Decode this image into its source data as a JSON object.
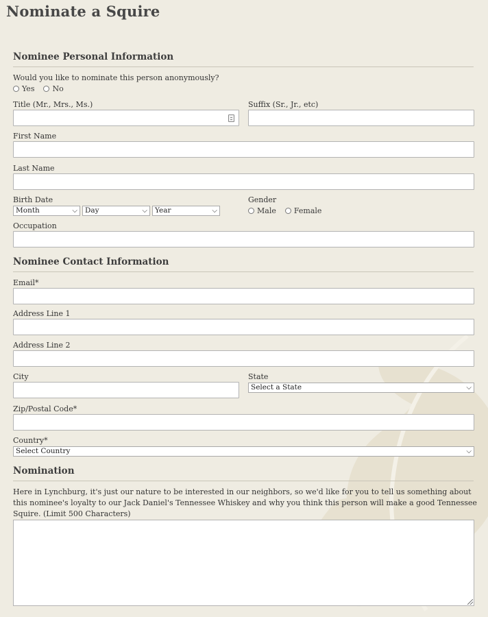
{
  "page": {
    "title": "Nominate a Squire"
  },
  "sections": {
    "personal": "Nominee Personal Information",
    "contact": "Nominee Contact Information",
    "nomination": "Nomination"
  },
  "anonymous": {
    "question": "Would you like to nominate this person anonymously?",
    "yes": "Yes",
    "no": "No"
  },
  "fields": {
    "title": "Title (Mr., Mrs., Ms.)",
    "suffix": "Suffix (Sr., Jr., etc)",
    "first_name": "First Name",
    "last_name": "Last Name",
    "birth_date": "Birth Date",
    "gender": "Gender",
    "occupation": "Occupation",
    "email": "Email*",
    "address1": "Address Line 1",
    "address2": "Address Line 2",
    "city": "City",
    "state": "State",
    "zip": "Zip/Postal Code*",
    "country": "Country*"
  },
  "selects": {
    "month": "Month",
    "day": "Day",
    "year": "Year",
    "state": "Select a State",
    "country": "Select Country"
  },
  "gender": {
    "male": "Male",
    "female": "Female"
  },
  "nomination": {
    "text": "Here in Lynchburg, it's just our nature to be interested in our neighbors, so we'd like for you to tell us something about this nominee's loyalty to our Jack Daniel's Tennessee Whiskey and why you think this person will make a good Tennessee Squire. (Limit 500 Characters)"
  },
  "icons": {
    "chevron": "chevron-down-icon",
    "radio": "radio-unselected-icon",
    "field": "autofill-icon",
    "watermark": "leaf-watermark-icon"
  }
}
